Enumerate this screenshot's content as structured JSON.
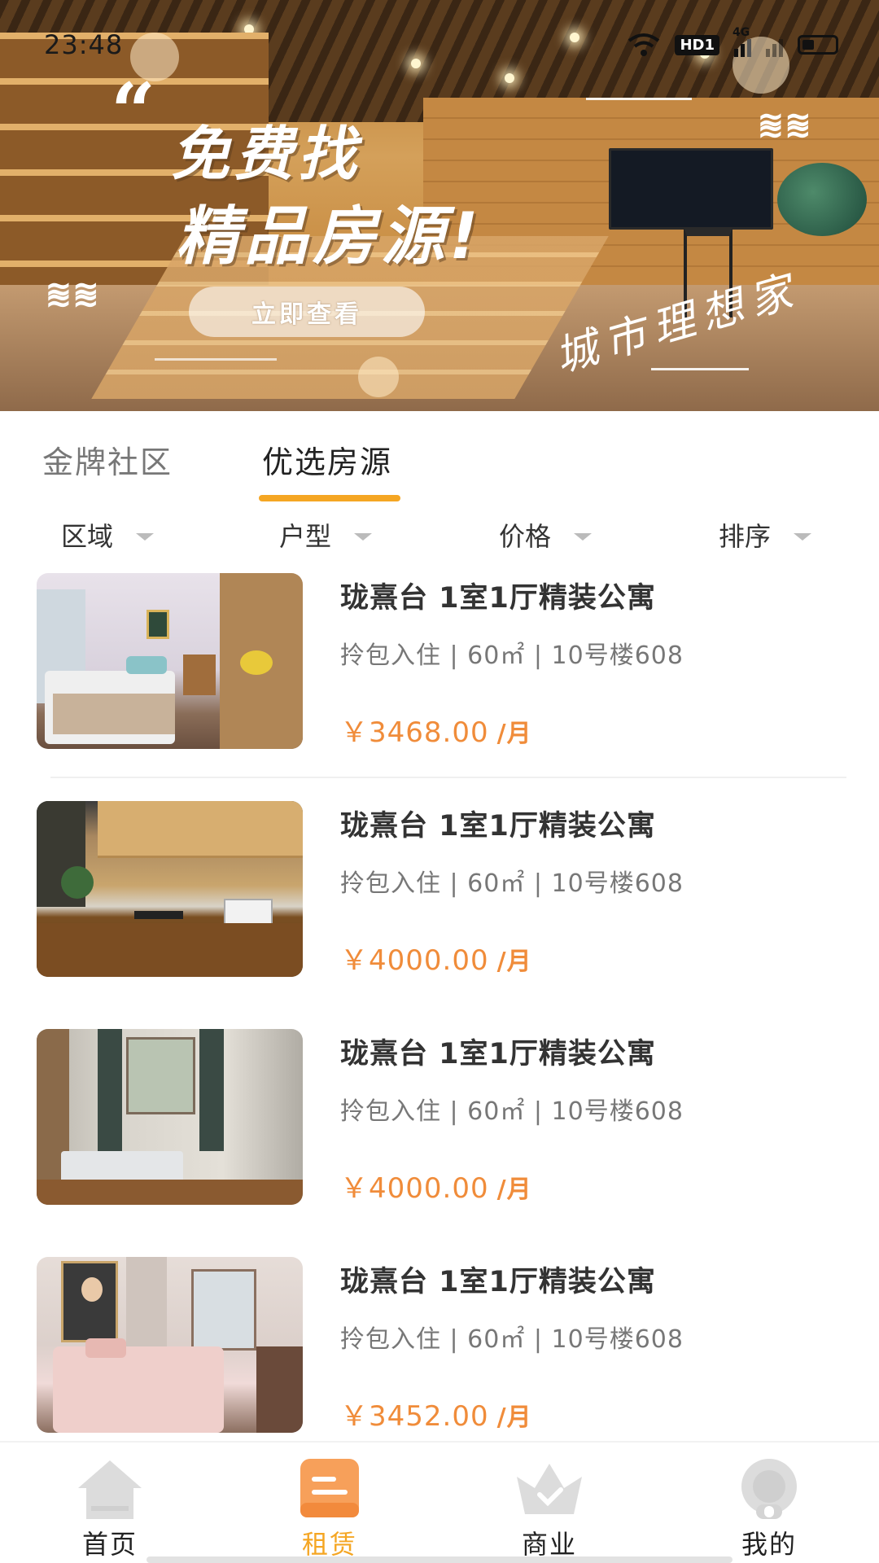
{
  "status_bar": {
    "time": "23:48",
    "network_badge": "HD1",
    "signal_label": "4G",
    "icons": [
      "wifi-icon",
      "signal-icon",
      "battery-icon"
    ]
  },
  "banner": {
    "quote_mark": "“",
    "line1": "免费找",
    "line2": "精品房源!",
    "button_label": "立即查看",
    "signature": "城市理想家"
  },
  "tabs": {
    "items": [
      {
        "label": "金牌社区",
        "active": false
      },
      {
        "label": "优选房源",
        "active": true
      }
    ]
  },
  "filters": {
    "items": [
      {
        "label": "区域"
      },
      {
        "label": "户型"
      },
      {
        "label": "价格"
      },
      {
        "label": "排序"
      }
    ]
  },
  "listings": [
    {
      "title": "珑熹台 1室1厅精装公寓",
      "meta": "拎包入住 | 60㎡ | 10号楼608",
      "price": "￥3468.00",
      "unit": "/月"
    },
    {
      "title": "珑熹台 1室1厅精装公寓",
      "meta": "拎包入住 | 60㎡ | 10号楼608",
      "price": "￥4000.00",
      "unit": "/月"
    },
    {
      "title": "珑熹台 1室1厅精装公寓",
      "meta": "拎包入住 | 60㎡ | 10号楼608",
      "price": "￥4000.00",
      "unit": "/月"
    },
    {
      "title": "珑熹台 1室1厅精装公寓",
      "meta": "拎包入住 | 60㎡ | 10号楼608",
      "price": "￥3452.00",
      "unit": "/月"
    }
  ],
  "bottom_nav": {
    "items": [
      {
        "label": "首页",
        "icon": "home-icon",
        "active": false
      },
      {
        "label": "租赁",
        "icon": "lease-icon",
        "active": true
      },
      {
        "label": "商业",
        "icon": "crown-icon",
        "active": false
      },
      {
        "label": "我的",
        "icon": "profile-icon",
        "active": false
      }
    ]
  },
  "colors": {
    "accent": "#f5a623",
    "price": "#f08c3a",
    "inactive_icon": "#d9d9d9"
  }
}
